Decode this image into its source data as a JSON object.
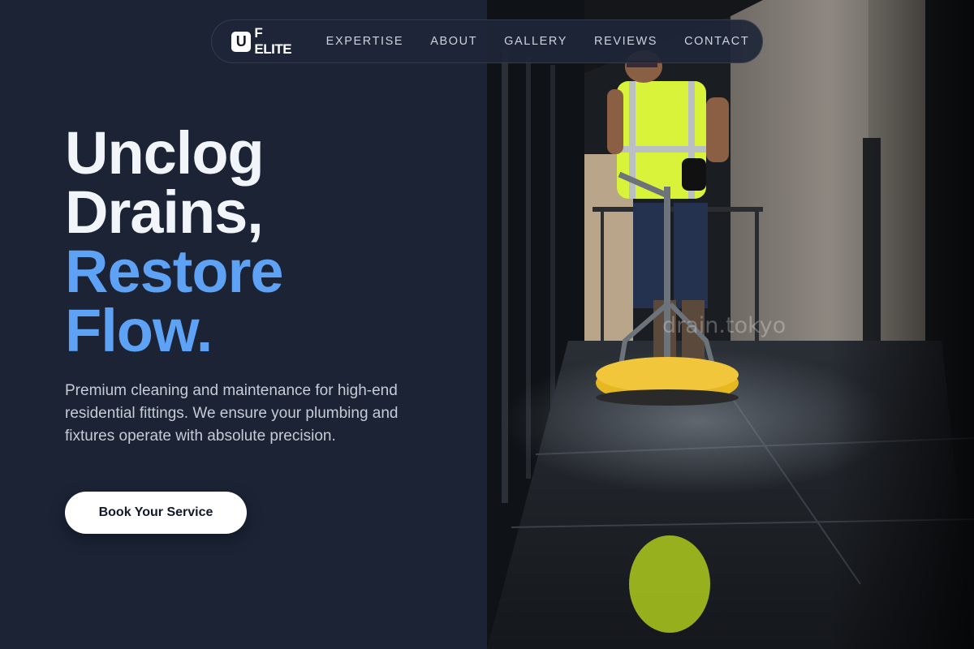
{
  "nav": {
    "logo_mark": "U",
    "logo_text": "F ELITE",
    "links": [
      {
        "label": "EXPERTISE"
      },
      {
        "label": "ABOUT"
      },
      {
        "label": "GALLERY"
      },
      {
        "label": "REVIEWS"
      },
      {
        "label": "CONTACT"
      }
    ]
  },
  "hero": {
    "title_lines": [
      "Unclog",
      "Drains,",
      "Restore",
      "Flow."
    ],
    "description": "Premium cleaning and maintenance for high-end residential fittings. We ensure your plumbing and fixtures operate with absolute precision.",
    "cta_label": "Book Your Service"
  },
  "image": {
    "watermark": "drain.tokyo",
    "subject": "worker-pressure-washing-icon"
  },
  "colors": {
    "background": "#1b2335",
    "accent_blue": "#5ea2f6",
    "title_white": "#f1f4f9",
    "vest_yellow": "#d9f23a",
    "machine_yellow": "#e5b822"
  }
}
